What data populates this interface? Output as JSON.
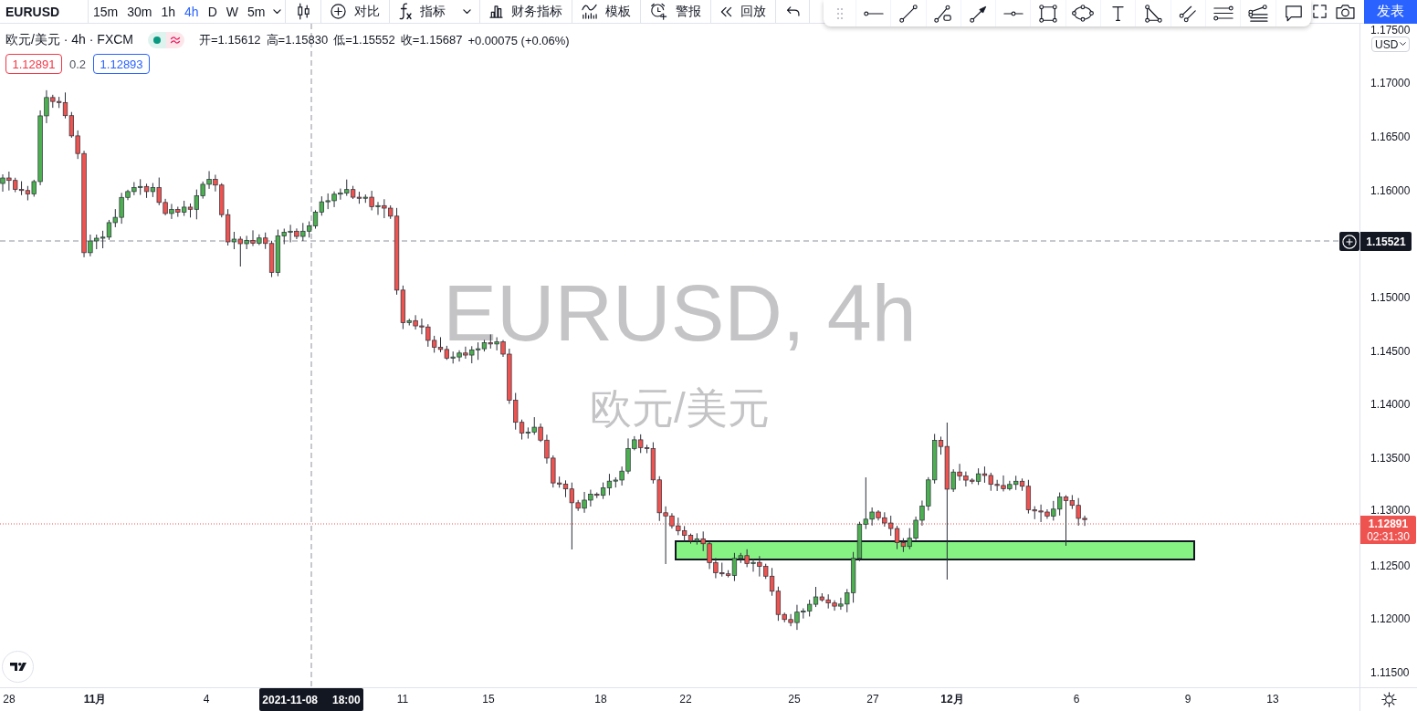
{
  "toolbar": {
    "symbol": "EURUSD",
    "intervals": [
      {
        "label": "15m",
        "selected": false
      },
      {
        "label": "30m",
        "selected": false
      },
      {
        "label": "1h",
        "selected": false
      },
      {
        "label": "4h",
        "selected": true
      },
      {
        "label": "D",
        "selected": false
      },
      {
        "label": "W",
        "selected": false
      },
      {
        "label": "5m",
        "selected": false
      }
    ],
    "buttons": [
      {
        "kind": "compare",
        "label": "对比"
      },
      {
        "kind": "indicators",
        "label": "指标"
      },
      {
        "kind": "financials",
        "label": "财务指标"
      },
      {
        "kind": "templates",
        "label": "模板"
      },
      {
        "kind": "alert",
        "label": "警报"
      },
      {
        "kind": "replay",
        "label": "回放"
      }
    ],
    "publish": "发表"
  },
  "legend": {
    "title": "欧元/美元 · 4h · FXCM",
    "values": [
      "开=1.15612",
      "高=1.15830",
      "低=1.15552",
      "收=1.15687"
    ],
    "change": "+0.00075 (+0.06%)"
  },
  "trade": {
    "sell": "1.12891",
    "spread": "0.2",
    "buy": "1.12893"
  },
  "chart": {
    "symbol_title": "EURUSD, 4h",
    "symbol_subtitle": "欧元/美元"
  },
  "price_axis": {
    "currency": "USD",
    "ticks": [
      "1.17500",
      "1.17000",
      "1.16500",
      "1.16000",
      "1.15000",
      "1.14500",
      "1.14000",
      "1.13500",
      "1.13000",
      "1.12500",
      "1.12000",
      "1.11500"
    ],
    "crosshair_price": "1.15521",
    "last_price": "1.12891",
    "countdown": "02:31:30"
  },
  "time_axis": {
    "ticks": [
      {
        "label": "28",
        "kind": "day"
      },
      {
        "label": "11月",
        "kind": "month"
      },
      {
        "label": "4",
        "kind": "day"
      },
      {
        "label": "11",
        "kind": "day"
      },
      {
        "label": "15",
        "kind": "day"
      },
      {
        "label": "18",
        "kind": "day"
      },
      {
        "label": "22",
        "kind": "day"
      },
      {
        "label": "25",
        "kind": "day"
      },
      {
        "label": "27",
        "kind": "day"
      },
      {
        "label": "12月",
        "kind": "month"
      },
      {
        "label": "6",
        "kind": "day"
      },
      {
        "label": "9",
        "kind": "day"
      },
      {
        "label": "13",
        "kind": "day"
      }
    ],
    "crosshair_date": "2021-11-08",
    "crosshair_time": "18:00"
  }
}
